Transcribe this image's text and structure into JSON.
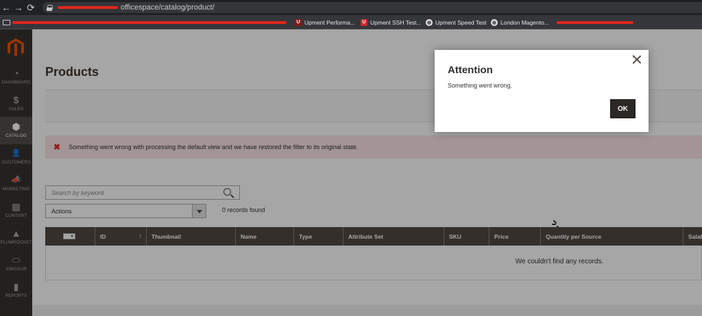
{
  "browser": {
    "url_visible": "officespace/catalog/product/",
    "bookmarks": [
      {
        "label": "Upment Performa...",
        "icon": "upment-app-icon",
        "color": "#8b1a1a"
      },
      {
        "label": "Upment SSH Test...",
        "icon": "upment-shield-icon",
        "color": "#d12a2a"
      },
      {
        "label": "Upment Speed Test",
        "icon": "globe-icon",
        "color": "#e8e8e8"
      },
      {
        "label": "London Magento...",
        "icon": "globe-icon",
        "color": "#e8e8e8"
      }
    ]
  },
  "sidebar": {
    "items": [
      {
        "label": "DASHBOARD",
        "icon": "dashboard-gauge-icon",
        "glyph": "◔"
      },
      {
        "label": "SALES",
        "icon": "dollar-icon",
        "glyph": "$"
      },
      {
        "label": "CATALOG",
        "icon": "cube-icon",
        "glyph": "⬢"
      },
      {
        "label": "CUSTOMERS",
        "icon": "person-icon",
        "glyph": "👤"
      },
      {
        "label": "MARKETING",
        "icon": "megaphone-icon",
        "glyph": "📣"
      },
      {
        "label": "CONTENT",
        "icon": "layout-icon",
        "glyph": "▦"
      },
      {
        "label": "PLUMROCKET",
        "icon": "plumrocket-icon",
        "glyph": "▲"
      },
      {
        "label": "SWISSUP",
        "icon": "swissup-icon",
        "glyph": "⬭"
      },
      {
        "label": "REPORTS",
        "icon": "bar-chart-icon",
        "glyph": "▮"
      }
    ],
    "active": "CATALOG"
  },
  "page": {
    "title": "Products",
    "error_message": "Something went wrong with processing the default view and we have restored the filter to its original state.",
    "search_placeholder": "Search by keyword",
    "actions_label": "Actions",
    "records_found": "0 records found",
    "empty_text": "We couldn't find any records."
  },
  "grid": {
    "columns": [
      "ID",
      "Thumbnail",
      "Name",
      "Type",
      "Attribute Set",
      "SKU",
      "Price",
      "Quantity per Source",
      "Salab"
    ]
  },
  "modal": {
    "title": "Attention",
    "message": "Something went wrong.",
    "ok_label": "OK"
  },
  "colors": {
    "sidebar": "#373330",
    "grid_header": "#514943",
    "error_bg": "#fae5e5",
    "magento_orange": "#eb5202"
  }
}
